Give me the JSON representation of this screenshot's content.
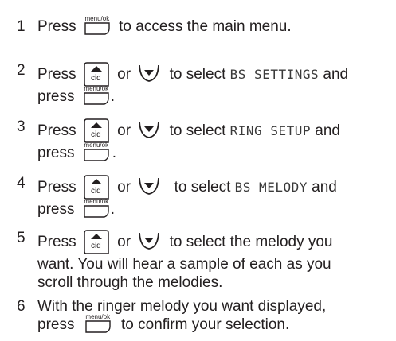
{
  "icons": {
    "menu_ok_caption": "menu/ok",
    "cid_caption": "cid",
    "up_key": "up-cid-key-icon",
    "down_key": "down-key-icon",
    "menu_key": "menu-ok-key-icon"
  },
  "steps": [
    {
      "number": "1",
      "press": "Press",
      "text_after": "to access the main menu."
    },
    {
      "number": "2",
      "press": "Press",
      "or": "or",
      "to_select": "to select",
      "lcd": "BS SETTINGS",
      "and": "and",
      "press2": "press",
      "end": "."
    },
    {
      "number": "3",
      "press": "Press",
      "or": "or",
      "to_select": "to select",
      "lcd": "RING SETUP",
      "and": "and",
      "press2": "press",
      "end": "."
    },
    {
      "number": "4",
      "press": "Press",
      "or": "or",
      "to_select": "to select",
      "lcd": "BS MELODY",
      "and": "and",
      "press2": "press",
      "end": "."
    },
    {
      "number": "5",
      "press": "Press",
      "or": "or",
      "line1_rest": "to select the melody you",
      "line2": "want. You will hear a sample of each as you",
      "line3": "scroll through the melodies."
    },
    {
      "number": "6",
      "line1": "With the ringer melody you want displayed,",
      "press": "press",
      "line2_rest": "to confirm your selection."
    }
  ]
}
